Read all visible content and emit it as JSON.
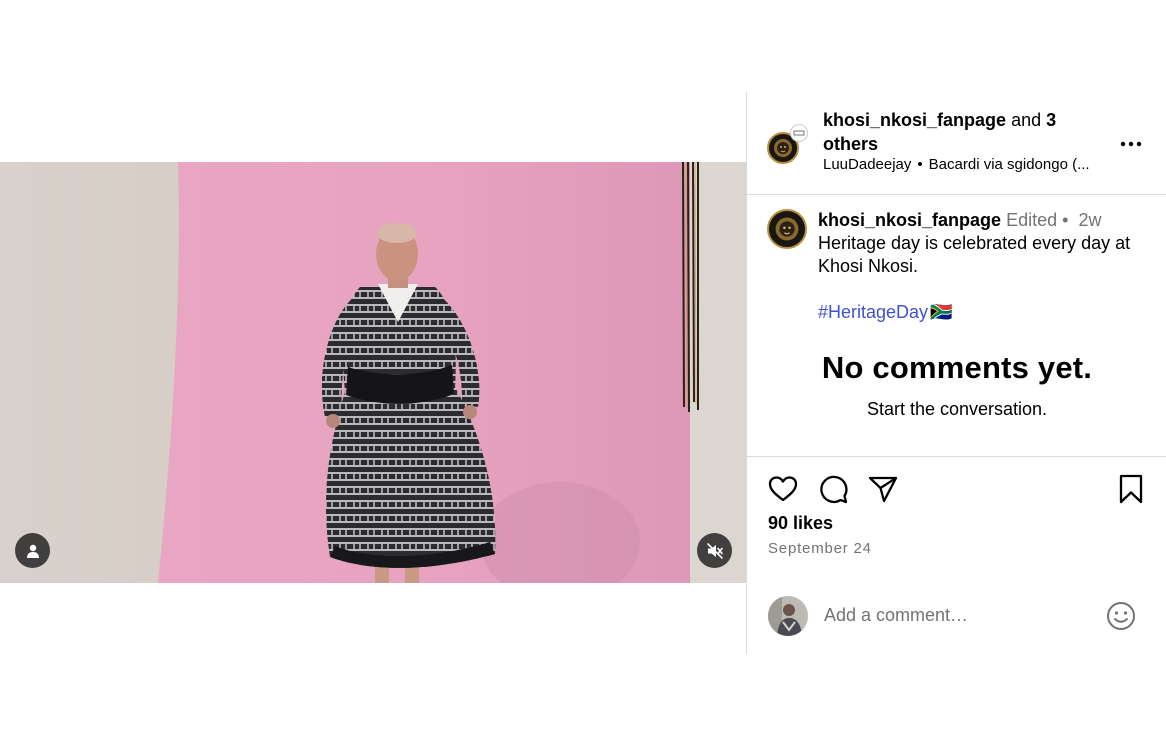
{
  "post": {
    "header": {
      "owner": "khosi_nkosi_fanpage",
      "collab_joiner": "and",
      "collab_count": "3",
      "collab_word": "others",
      "audio_artist": "LuuDadeejay",
      "audio_track": "Bacardi via sgidongo (..."
    },
    "caption": {
      "username": "khosi_nkosi_fanpage",
      "edited": "Edited",
      "time": "2w",
      "text": "Heritage day is celebrated every day at Khosi Nkosi.",
      "hashtag": "#HeritageDay",
      "flag_emoji": "🇿🇦"
    },
    "comments_empty": {
      "title": "No comments yet.",
      "subtitle": "Start the conversation."
    },
    "likes": "90 likes",
    "date": "September 24",
    "comment_placeholder": "Add a comment…"
  },
  "icons": {
    "tag": "user-tag-icon",
    "mute": "muted-speaker-icon",
    "more": "more-options-icon",
    "like": "heart-icon",
    "comment": "comment-bubble-icon",
    "share": "paper-plane-icon",
    "save": "bookmark-icon",
    "emoji": "smiley-icon"
  },
  "colors": {
    "hashtag": "#3f51d4",
    "muted_text": "#737373",
    "divider": "#dbdbdb",
    "backdrop_pink": "#e3a0bd"
  }
}
